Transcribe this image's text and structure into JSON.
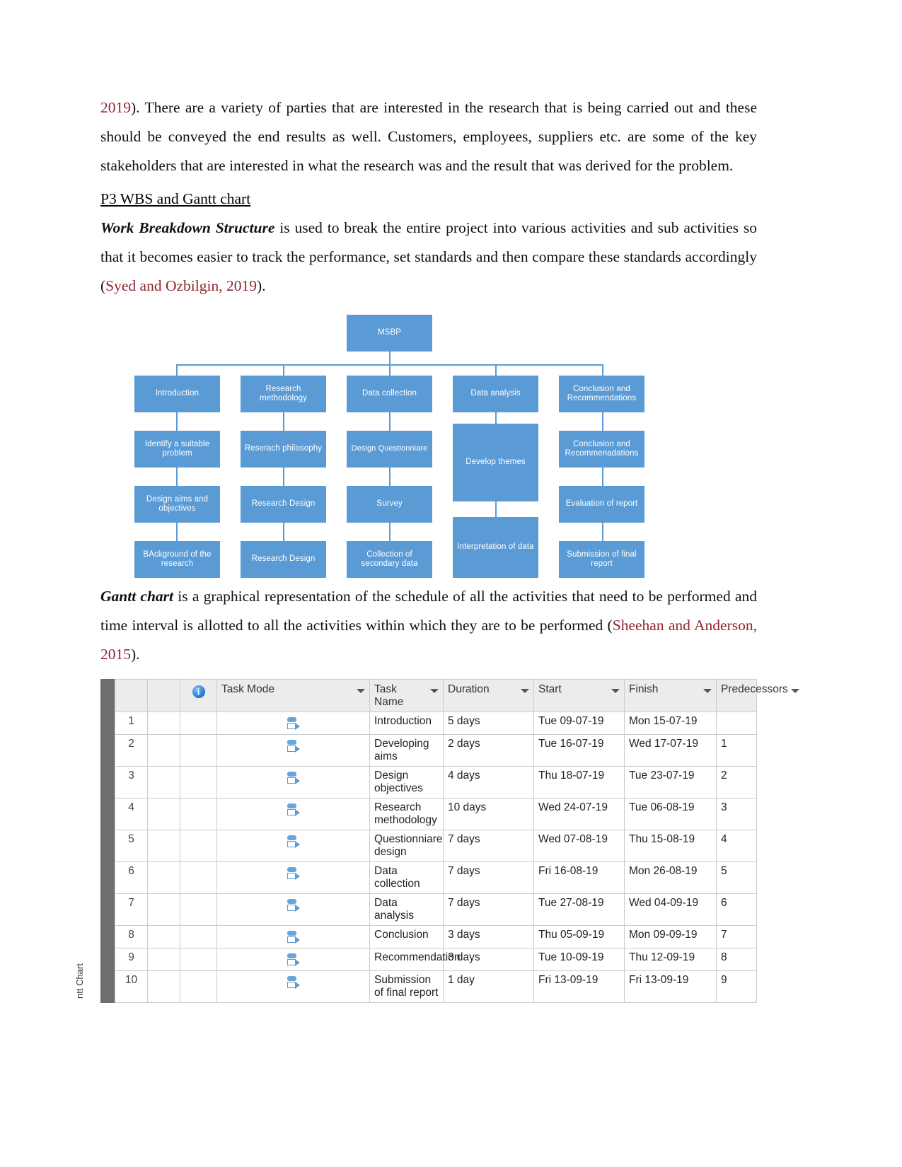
{
  "document": {
    "paragraphs": [
      {
        "id": "p1",
        "segments": [
          {
            "text": "2019",
            "style": "cite"
          },
          {
            "text": "). There are a variety of parties that are interested in the research that is being carried out and these should be conveyed the end results as well. Customers, employees, suppliers etc. are some of the key stakeholders that are interested in what the research was and the result that was derived for the problem.",
            "style": "normal"
          }
        ]
      }
    ],
    "heading": "P3 WBS and Gantt chart",
    "wbs_paragraph": {
      "lead": "Work Breakdown Structure",
      "body": " is used to break the entire project into various activities and sub activities so that it becomes easier to track the performance, set standards and then compare these standards accordingly (",
      "citation": "Syed and Ozbilgin, 2019",
      "tail": ")."
    },
    "gantt_paragraph": {
      "lead": "Gantt chart",
      "body": " is a graphical representation of the schedule of all the activities that need to be performed and time interval is allotted to all the activities within which they are to be performed (",
      "citation": "Sheehan and Anderson, 2015",
      "tail": ")."
    }
  },
  "wbs": {
    "root": "MSBP",
    "accent_color": "#5b9bd5",
    "columns": [
      {
        "header": "Introduction",
        "nodes": [
          "Identify a suitable problem",
          "Design aims and objectives",
          "BAckground of the research"
        ]
      },
      {
        "header": "Research methodology",
        "nodes": [
          "Reserach philosophy",
          "Research Design",
          "Research Design"
        ]
      },
      {
        "header": "Data collection",
        "nodes": [
          "Design Questionniare",
          "Survey",
          "Collection of secondary data"
        ]
      },
      {
        "header": "Data analysis",
        "nodes": [
          "Develop themes",
          "Interpretation of data"
        ]
      },
      {
        "header": "Conclusion and Recommendations",
        "nodes": [
          "Conclusion and Recommenadations",
          "Evaluation of report",
          "Submission of final report"
        ]
      }
    ]
  },
  "gantt": {
    "side_label": "ntt Chart",
    "header_highlight_color": "#ffd966",
    "columns": [
      {
        "key": "rownum",
        "label": ""
      },
      {
        "key": "indicator",
        "label": ""
      },
      {
        "key": "info",
        "label": "info-icon"
      },
      {
        "key": "task_mode",
        "label": "Task Mode"
      },
      {
        "key": "task_name",
        "label": "Task Name"
      },
      {
        "key": "duration",
        "label": "Duration"
      },
      {
        "key": "start",
        "label": "Start"
      },
      {
        "key": "finish",
        "label": "Finish"
      },
      {
        "key": "predecessors",
        "label": "Predecessors"
      }
    ],
    "rows": [
      {
        "num": "1",
        "name": "Introduction",
        "duration": "5 days",
        "start": "Tue 09-07-19",
        "finish": "Mon 15-07-19",
        "pred": ""
      },
      {
        "num": "2",
        "name": "Developing aims",
        "duration": "2 days",
        "start": "Tue 16-07-19",
        "finish": "Wed 17-07-19",
        "pred": "1"
      },
      {
        "num": "3",
        "name": "Design objectives",
        "duration": "4 days",
        "start": "Thu 18-07-19",
        "finish": "Tue 23-07-19",
        "pred": "2"
      },
      {
        "num": "4",
        "name": "Research methodology",
        "duration": "10 days",
        "start": "Wed 24-07-19",
        "finish": "Tue 06-08-19",
        "pred": "3"
      },
      {
        "num": "5",
        "name": "Questionniare design",
        "duration": "7 days",
        "start": "Wed 07-08-19",
        "finish": "Thu 15-08-19",
        "pred": "4"
      },
      {
        "num": "6",
        "name": "Data collection",
        "duration": "7 days",
        "start": "Fri 16-08-19",
        "finish": "Mon 26-08-19",
        "pred": "5"
      },
      {
        "num": "7",
        "name": "Data analysis",
        "duration": "7 days",
        "start": "Tue 27-08-19",
        "finish": "Wed 04-09-19",
        "pred": "6"
      },
      {
        "num": "8",
        "name": "Conclusion",
        "duration": "3 days",
        "start": "Thu 05-09-19",
        "finish": "Mon 09-09-19",
        "pred": "7"
      },
      {
        "num": "9",
        "name": "Recommendation",
        "duration": "3 days",
        "start": "Tue 10-09-19",
        "finish": "Thu 12-09-19",
        "pred": "8"
      },
      {
        "num": "10",
        "name": "Submission of final report",
        "duration": "1 day",
        "start": "Fri 13-09-19",
        "finish": "Fri 13-09-19",
        "pred": "9"
      }
    ]
  }
}
